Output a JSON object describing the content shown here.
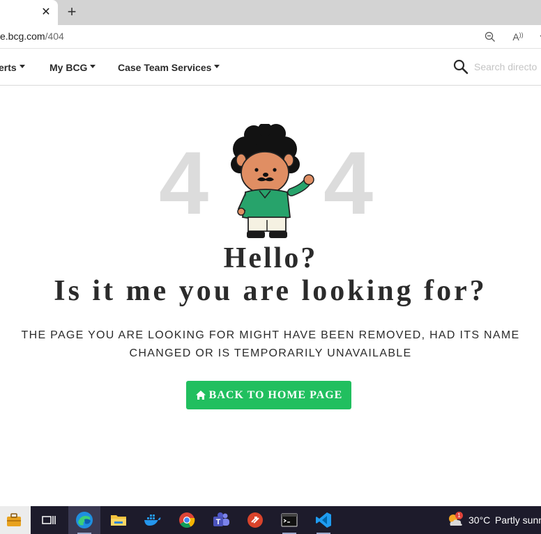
{
  "browser": {
    "tab_close_glyph": "✕",
    "new_tab_glyph": "+",
    "url_host": "e.bcg.com",
    "url_path": "/404",
    "read_aloud_label": "A"
  },
  "navbar": {
    "items": [
      {
        "label": "erts"
      },
      {
        "label": "My BCG"
      },
      {
        "label": "Case Team Services"
      }
    ],
    "search_placeholder": "Search directo"
  },
  "error": {
    "digit_left": "4",
    "digit_right": "4",
    "hello_line1": "Hello?",
    "hello_line2": "Is it me you are looking for?",
    "message_line1": "THE PAGE YOU ARE LOOKING FOR MIGHT HAVE BEEN REMOVED, HAD ITS NAME",
    "message_line2": "CHANGED OR IS TEMPORARILY UNAVAILABLE",
    "button_label": "BACK TO HOME PAGE",
    "button_color": "#21bf5f"
  },
  "taskbar": {
    "apps": [
      "briefcase-icon",
      "task-view-icon",
      "edge-icon",
      "file-explorer-icon",
      "docker-icon",
      "chrome-icon",
      "teams-icon",
      "remote-desktop-icon",
      "terminal-icon",
      "vscode-icon"
    ],
    "weather_badge": "1",
    "temperature": "30°C",
    "weather_text": "Partly sunn"
  }
}
